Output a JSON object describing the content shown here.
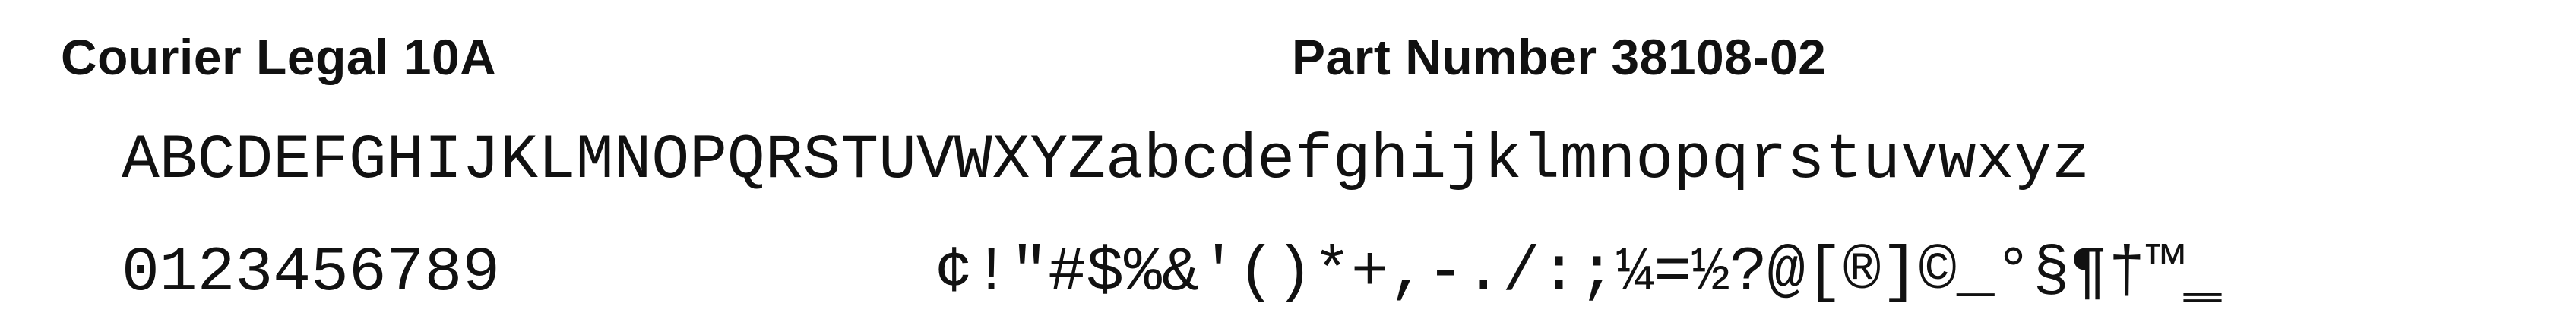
{
  "sheet": {
    "font_name": "Courier Legal 10A",
    "part_number": "Part Number 38108-02",
    "alphabet": "ABCDEFGHIJKLMNOPQRSTUVWXYZabcdefghijklmnopqrstuvwxyz",
    "digits": "0123456789",
    "symbols": "¢!\"#$%&'()*+,-./:;¼=½?@[®]©_°§¶†™‗"
  }
}
